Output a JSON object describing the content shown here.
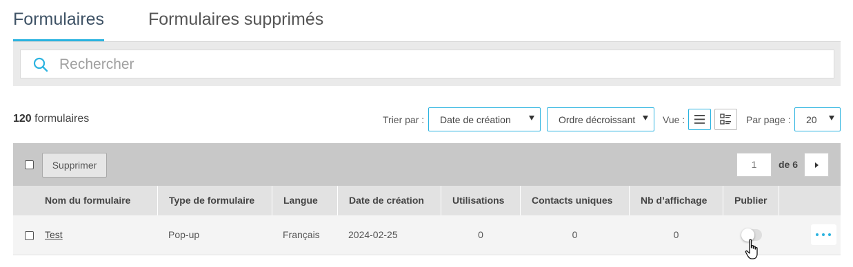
{
  "tabs": [
    {
      "label": "Formulaires",
      "active": true
    },
    {
      "label": "Formulaires supprimés",
      "active": false
    }
  ],
  "search": {
    "placeholder": "Rechercher",
    "value": ""
  },
  "toolbar": {
    "count_number": "120",
    "count_label": " formulaires",
    "sort_label": "Trier par :",
    "sort_value": "Date de création",
    "order_value": "Ordre décroissant",
    "view_label": "Vue :",
    "perpage_label": "Par page :",
    "perpage_value": "20"
  },
  "actions": {
    "delete_label": "Supprimer",
    "page_current": "1",
    "page_of": "de 6"
  },
  "table": {
    "columns": [
      "Nom du formulaire",
      "Type de formulaire",
      "Langue",
      "Date de création",
      "Utilisations",
      "Contacts uniques",
      "Nb d’affichage",
      "Publier"
    ],
    "rows": [
      {
        "name": "Test",
        "type": "Pop-up",
        "language": "Français",
        "created": "2024-02-25",
        "uses": "0",
        "unique_contacts": "0",
        "views": "0",
        "published": false
      }
    ]
  },
  "colors": {
    "accent": "#2bb3e0",
    "bar": "#c8c8c8",
    "header": "#e2e2e2"
  },
  "icons": [
    "search-icon",
    "list-view-icon",
    "grid-view-icon",
    "chevron-right-icon",
    "more-icon",
    "hand-cursor-icon"
  ]
}
